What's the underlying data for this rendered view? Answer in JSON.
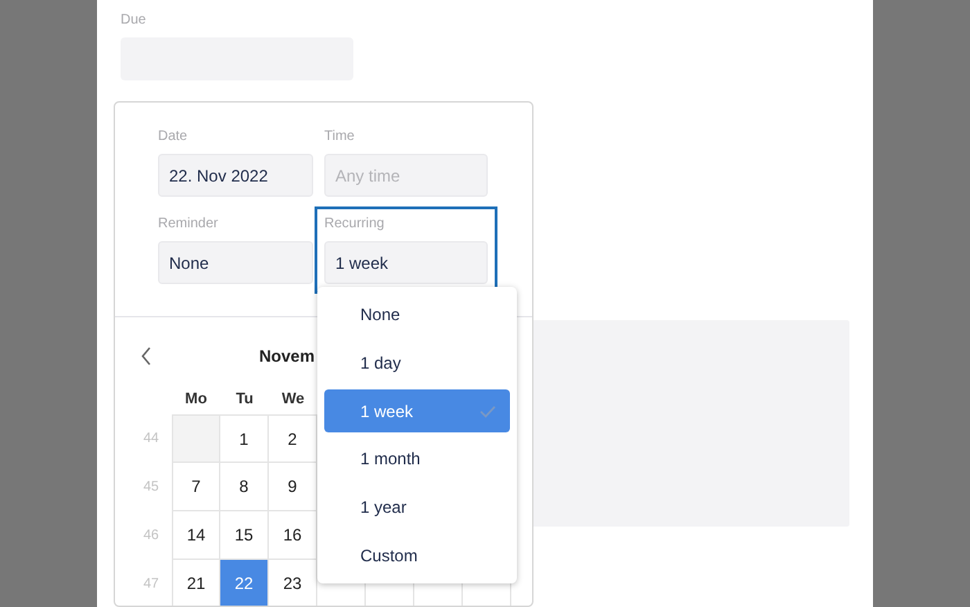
{
  "due": {
    "label": "Due"
  },
  "date": {
    "label": "Date",
    "value": "22. Nov 2022"
  },
  "time": {
    "label": "Time",
    "placeholder": "Any time"
  },
  "reminder": {
    "label": "Reminder",
    "value": "None"
  },
  "recurring": {
    "label": "Recurring",
    "value": "1 week",
    "focused": true
  },
  "calendar": {
    "title": "Novem",
    "weekdays": [
      "Mo",
      "Tu",
      "We"
    ],
    "weeks": [
      {
        "number": "44",
        "days": [
          {
            "kind": "blank"
          },
          {
            "kind": "day",
            "label": "1",
            "selected": false
          },
          {
            "kind": "day",
            "label": "2",
            "selected": false
          }
        ]
      },
      {
        "number": "45",
        "days": [
          {
            "kind": "day",
            "label": "7",
            "selected": false
          },
          {
            "kind": "day",
            "label": "8",
            "selected": false
          },
          {
            "kind": "day",
            "label": "9",
            "selected": false
          }
        ]
      },
      {
        "number": "46",
        "days": [
          {
            "kind": "day",
            "label": "14",
            "selected": false
          },
          {
            "kind": "day",
            "label": "15",
            "selected": false
          },
          {
            "kind": "day",
            "label": "16",
            "selected": false
          }
        ]
      },
      {
        "number": "47",
        "days": [
          {
            "kind": "day",
            "label": "21",
            "selected": false
          },
          {
            "kind": "day",
            "label": "22",
            "selected": true
          },
          {
            "kind": "day",
            "label": "23",
            "selected": false
          }
        ]
      }
    ]
  },
  "options": [
    {
      "label": "None",
      "selected": false
    },
    {
      "label": "1 day",
      "selected": false
    },
    {
      "label": "1 week",
      "selected": true
    },
    {
      "label": "1 month",
      "selected": false
    },
    {
      "label": "1 year",
      "selected": false
    },
    {
      "label": "Custom",
      "selected": false
    }
  ]
}
